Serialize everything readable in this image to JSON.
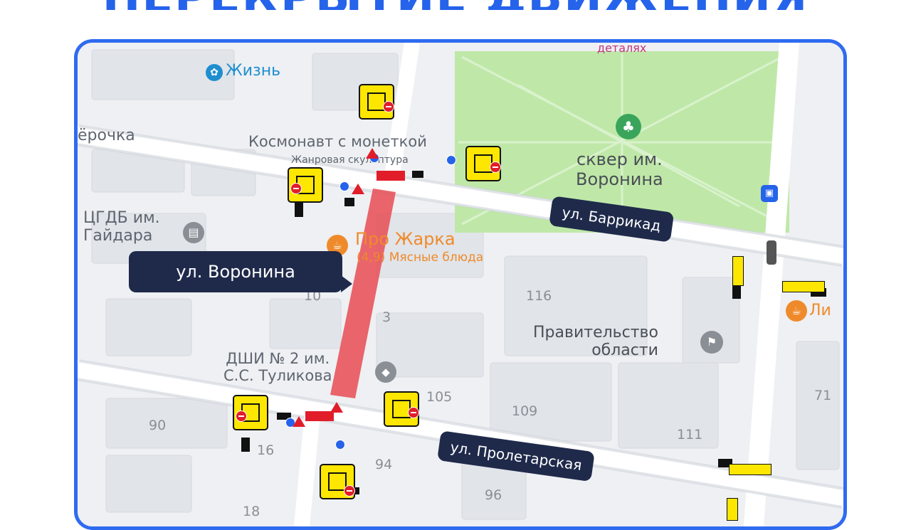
{
  "title": "ПЕРЕКРЫТИЕ ДВИЖЕНИЯ",
  "streets": {
    "voronina": "ул. Воронина",
    "barrikad": "ул. Баррикад",
    "proletarskaya": "ул. Пролетарская"
  },
  "pois": {
    "zhizn": "Жизнь",
    "cosmonaut": "Космонавт с монеткой",
    "sculpture": "Жанровая скульптура",
    "detalyah": "деталях",
    "square": [
      "сквер им.",
      "Воронина"
    ],
    "yorochka": "ёрочка",
    "cgdb": [
      "ЦГДБ им.",
      "Гайдара"
    ],
    "prozharka": "Про Жарка",
    "prozharka_sub": "(4,9) Мясные блюда",
    "government": [
      "Правительство",
      "области"
    ],
    "dshi": [
      "ДШИ № 2 им.",
      "С.С. Туликова"
    ],
    "li": "Ли"
  },
  "house_numbers": [
    "116",
    "3",
    "10",
    "105",
    "109",
    "90",
    "16",
    "94",
    "111",
    "71",
    "96",
    "18"
  ],
  "colors": {
    "accent": "#2f6bf0",
    "closed_section": "#e8545c",
    "street_label_bg": "#1f2a4b",
    "park": "#bfe8a8",
    "sign_yellow": "#fde600"
  },
  "icons": [
    "paw-icon",
    "tree-icon",
    "book-icon",
    "flag-icon",
    "food-icon",
    "graduation-icon",
    "traffic-light-icon",
    "bus-stop-icon"
  ]
}
